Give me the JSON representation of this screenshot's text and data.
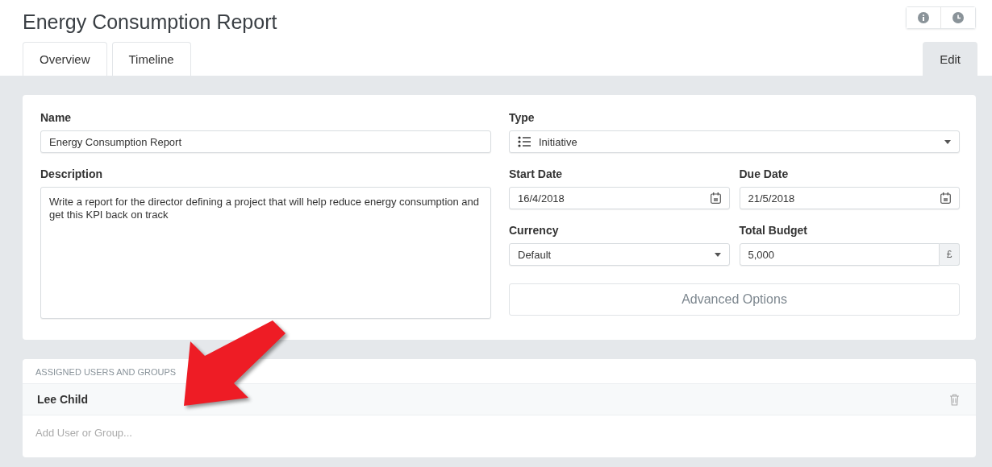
{
  "title": "Energy Consumption Report",
  "tabs": [
    {
      "label": "Overview",
      "selected": false
    },
    {
      "label": "Timeline",
      "selected": false
    },
    {
      "label": "Edit",
      "selected": true
    }
  ],
  "form": {
    "name": {
      "label": "Name",
      "value": "Energy Consumption Report"
    },
    "description": {
      "label": "Description",
      "value": "Write a report for the director defining a project that will help reduce energy consumption and get this KPI back on track"
    },
    "type": {
      "label": "Type",
      "value": "Initiative"
    },
    "start_date": {
      "label": "Start Date",
      "value": "16/4/2018"
    },
    "due_date": {
      "label": "Due Date",
      "value": "21/5/2018"
    },
    "currency": {
      "label": "Currency",
      "value": "Default"
    },
    "total_budget": {
      "label": "Total Budget",
      "value": "5,000",
      "addon": "£"
    },
    "advanced_button": "Advanced Options"
  },
  "assigned": {
    "heading": "ASSIGNED USERS AND GROUPS",
    "users": [
      "Lee Child"
    ],
    "add_placeholder": "Add User or Group..."
  },
  "annotation": {
    "kind": "arrow"
  }
}
